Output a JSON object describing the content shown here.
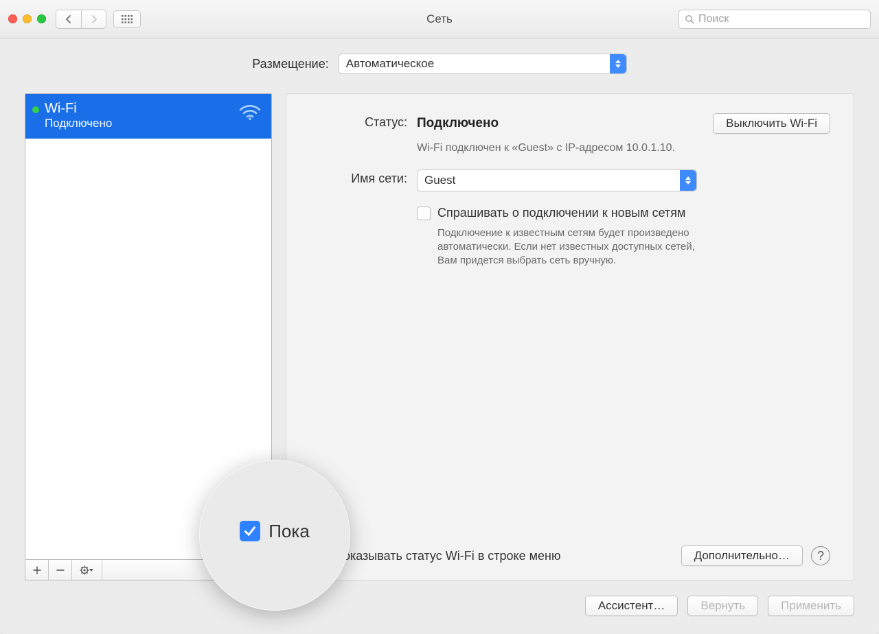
{
  "window": {
    "title": "Сеть"
  },
  "search": {
    "placeholder": "Поиск"
  },
  "location": {
    "label": "Размещение:",
    "value": "Автоматическое"
  },
  "sidebar": {
    "items": [
      {
        "name": "Wi-Fi",
        "status": "Подключено"
      }
    ]
  },
  "detail": {
    "status_label": "Статус:",
    "status_value": "Подключено",
    "turn_off_btn": "Выключить Wi-Fi",
    "status_desc": "Wi-Fi подключен к «Guest» с IP-адресом 10.0.1.10.",
    "network_label": "Имя сети:",
    "network_value": "Guest",
    "ask_label": "Спрашивать о подключении к новым сетям",
    "ask_desc": "Подключение к известным сетям будет произведено автоматически. Если нет известных доступных сетей, Вам придется выбрать сеть вручную.",
    "show_status_label": "Показывать статус Wi-Fi в строке меню",
    "advanced_btn": "Дополнительно…"
  },
  "footer": {
    "assistant": "Ассистент…",
    "revert": "Вернуть",
    "apply": "Применить"
  },
  "zoom": {
    "text": "Пока"
  }
}
